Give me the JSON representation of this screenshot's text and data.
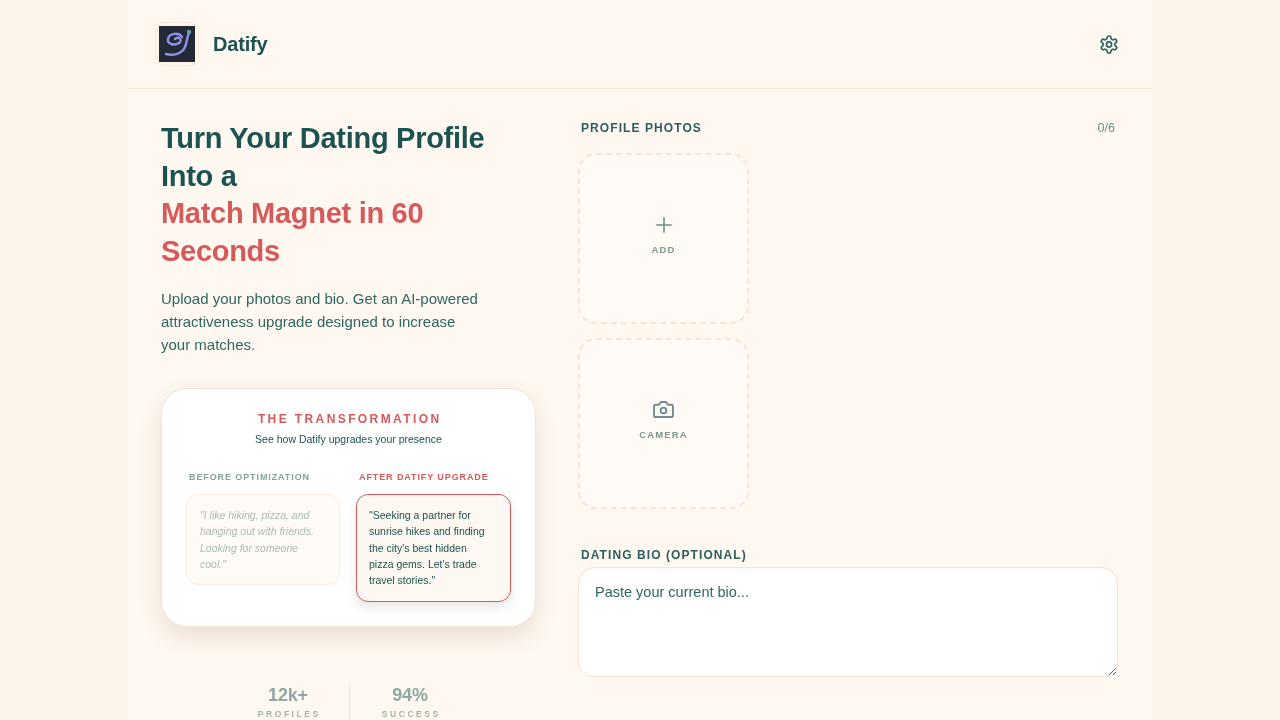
{
  "header": {
    "brand": "Datify"
  },
  "hero": {
    "title": "Turn Your Dating Profile Into a",
    "title_highlight": "Match Magnet in 60 Seconds",
    "description": "Upload your photos and bio. Get an AI-powered attractiveness upgrade designed to increase your matches."
  },
  "transformation": {
    "title": "THE TRANSFORMATION",
    "subtitle": "See how Datify upgrades your presence",
    "before": {
      "label": "BEFORE OPTIMIZATION",
      "text": "\"I like hiking, pizza, and hanging out with friends. Looking for someone cool.\""
    },
    "after": {
      "label": "AFTER DATIFY UPGRADE",
      "text": "\"Seeking a partner for sunrise hikes and finding the city's best hidden pizza gems. Let's trade travel stories.\""
    }
  },
  "stats": [
    {
      "value": "12k+",
      "label": "PROFILES"
    },
    {
      "value": "94%",
      "label": "SUCCESS"
    }
  ],
  "photos": {
    "label": "PROFILE PHOTOS",
    "count": "0/6",
    "slots": [
      {
        "kind": "add",
        "label": "ADD"
      },
      {
        "kind": "camera",
        "label": "CAMERA"
      }
    ]
  },
  "bio": {
    "label": "DATING BIO (OPTIONAL)",
    "placeholder": "Paste your current bio..."
  }
}
